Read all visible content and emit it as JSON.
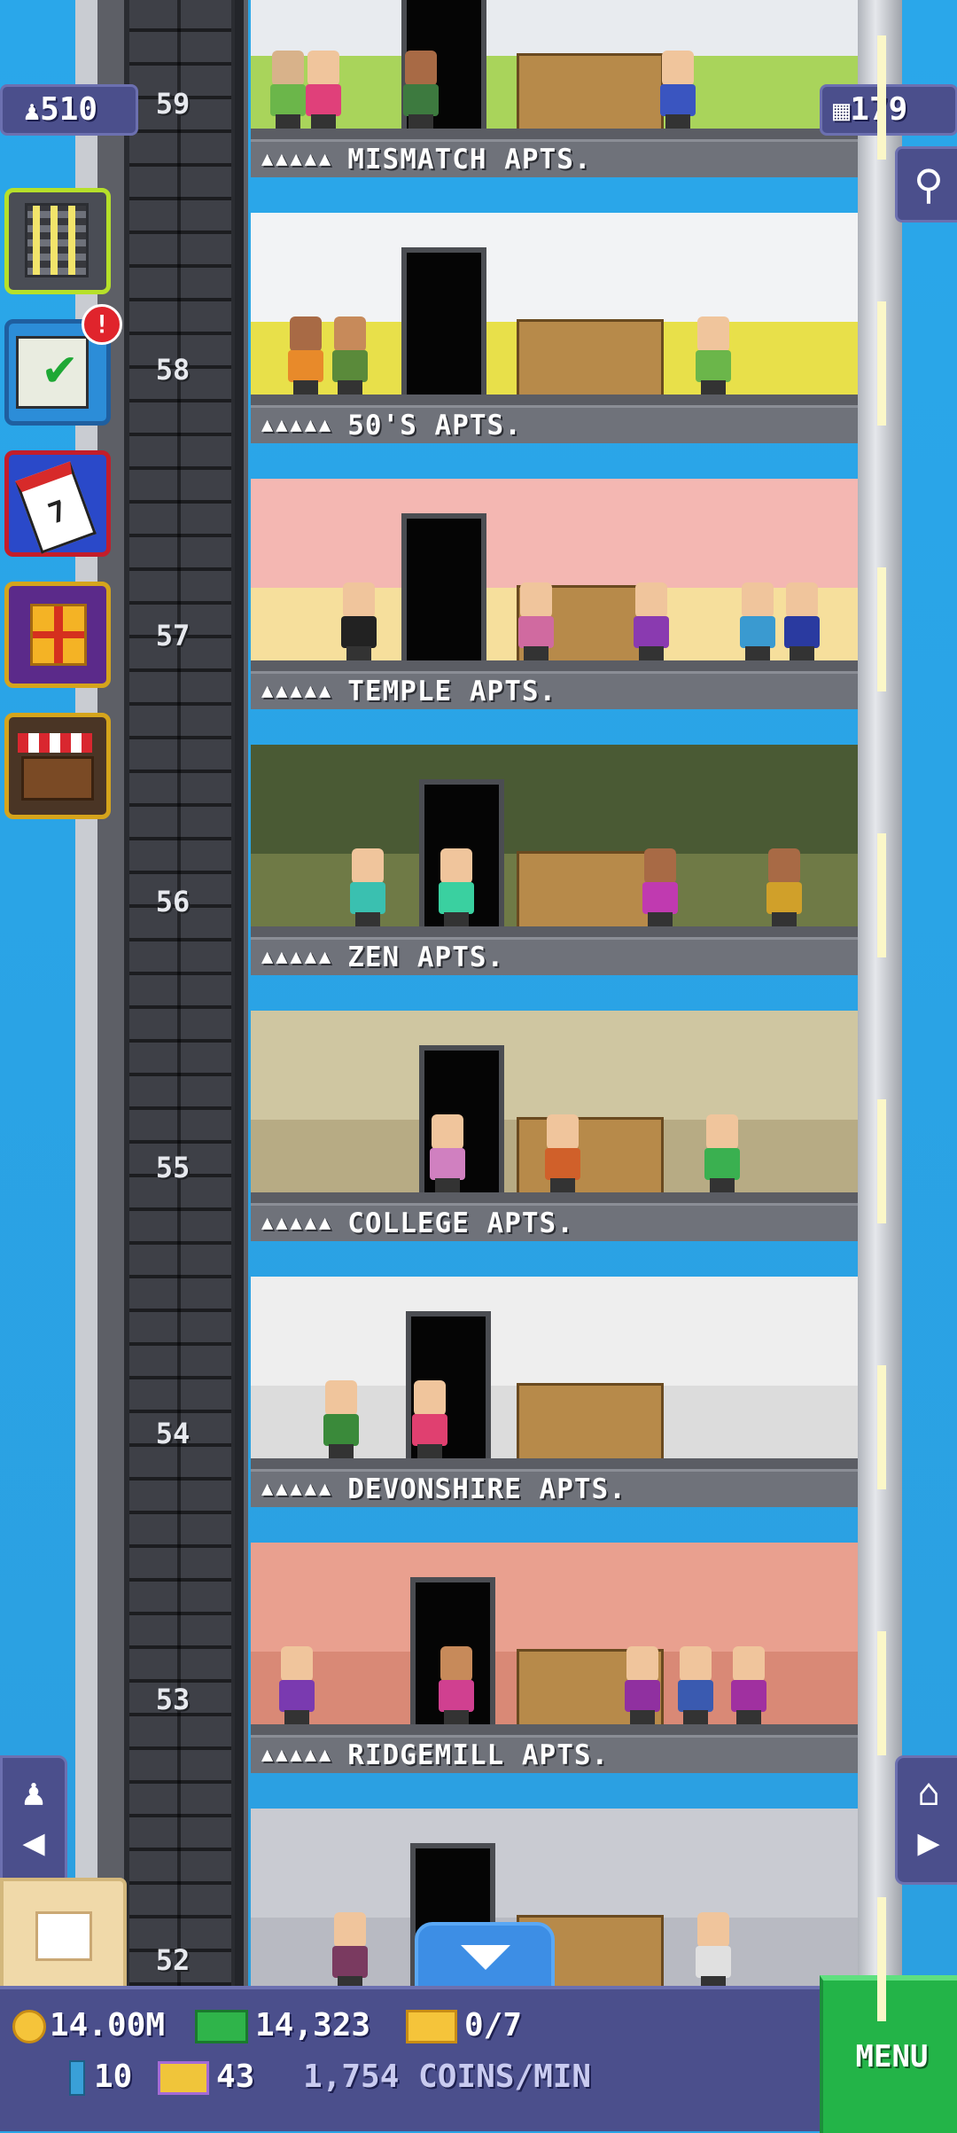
{
  "hud": {
    "population": "510",
    "floors": "179"
  },
  "floors": [
    {
      "number": "59",
      "name": "MISMATCH APTS.",
      "wall": "#e8ebef",
      "accent": "#a9d45b"
    },
    {
      "number": "58",
      "name": "50'S APTS.",
      "wall": "#f2f3f5",
      "accent": "#e8e04a"
    },
    {
      "number": "57",
      "name": "TEMPLE APTS.",
      "wall": "#f4b7b2",
      "accent": "#f6df9c"
    },
    {
      "number": "56",
      "name": "ZEN APTS.",
      "wall": "#4a5a34",
      "accent": "#6f7a46"
    },
    {
      "number": "55",
      "name": "COLLEGE APTS.",
      "wall": "#cfc6a1",
      "accent": "#b7ab84"
    },
    {
      "number": "54",
      "name": "DEVONSHIRE APTS.",
      "wall": "#eeeeee",
      "accent": "#dcdcdc"
    },
    {
      "number": "53",
      "name": "RIDGEMILL APTS.",
      "wall": "#e9a08f",
      "accent": "#d98976"
    },
    {
      "number": "52",
      "name": "",
      "wall": "#c9cbd2",
      "accent": "#b8bac2"
    }
  ],
  "side_buttons": {
    "notification_badge": "!"
  },
  "bottom": {
    "coins": "14.00M",
    "bux": "14,323",
    "tickets": "0/7",
    "tower_bux": "10",
    "vip": "43",
    "rate": "1,754 COINS/MIN",
    "menu_label": "MENU"
  },
  "icons": {
    "population": "person-icon",
    "floors": "building-grid-icon",
    "search": "magnifier-icon",
    "down": "down-arrow-icon"
  }
}
